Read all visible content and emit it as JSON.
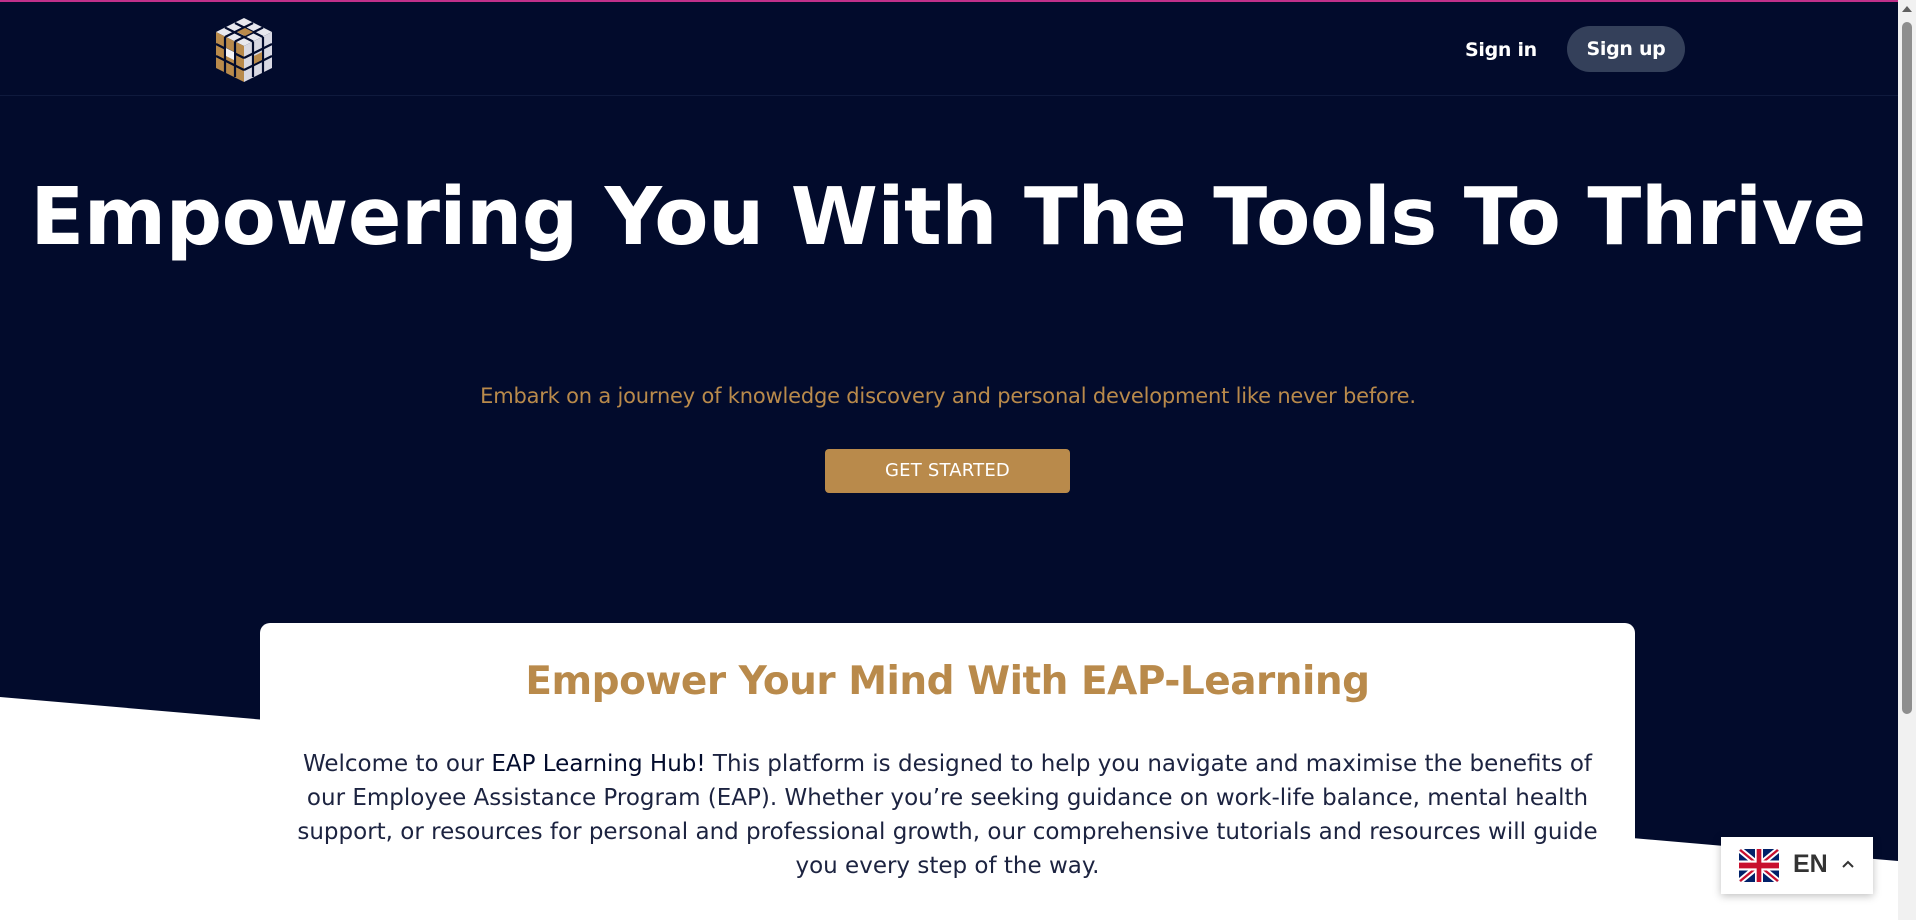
{
  "header": {
    "signin_label": "Sign in",
    "signup_label": "Sign up"
  },
  "hero": {
    "title": "Empowering You With The Tools To Thrive",
    "subtitle": "Embark on a journey of knowledge discovery and personal development like never before.",
    "cta_label": "GET STARTED"
  },
  "intro_card": {
    "title": "Empower Your Mind With EAP-Learning",
    "body_prefix": "Welcome to our ",
    "body_highlight": "EAP Learning Hub!",
    "body_rest": " This platform is designed to help you navigate and maximise the benefits of our Employee Assistance Program (EAP). Whether you’re seeking guidance on work-life balance, mental health support, or resources for personal and professional growth, our comprehensive tutorials and resources will guide you every step of the way."
  },
  "language_selector": {
    "code": "EN",
    "flag_icon": "uk-flag-icon"
  },
  "colors": {
    "background": "#020b2c",
    "accent_gold": "#b98a4b",
    "signup_button": "#34405a",
    "top_accent": "#c0308a"
  }
}
